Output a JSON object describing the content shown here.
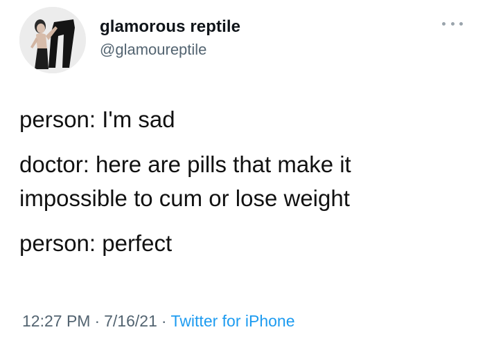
{
  "author": {
    "display_name": "glamorous reptile",
    "handle": "@glamoureptile",
    "avatar_icon": "profile-photo-avatar"
  },
  "tweet": {
    "lines": [
      "person: I'm sad",
      "doctor: here are pills that make it",
      "impossible to cum or lose weight",
      "person: perfect"
    ],
    "time": "12:27 PM",
    "date": "7/16/21",
    "separator": "·",
    "source": "Twitter for iPhone"
  },
  "icons": {
    "more": "more-options-icon"
  },
  "colors": {
    "text": "#0f1419",
    "secondary": "#536471",
    "link": "#1d9bf0"
  }
}
